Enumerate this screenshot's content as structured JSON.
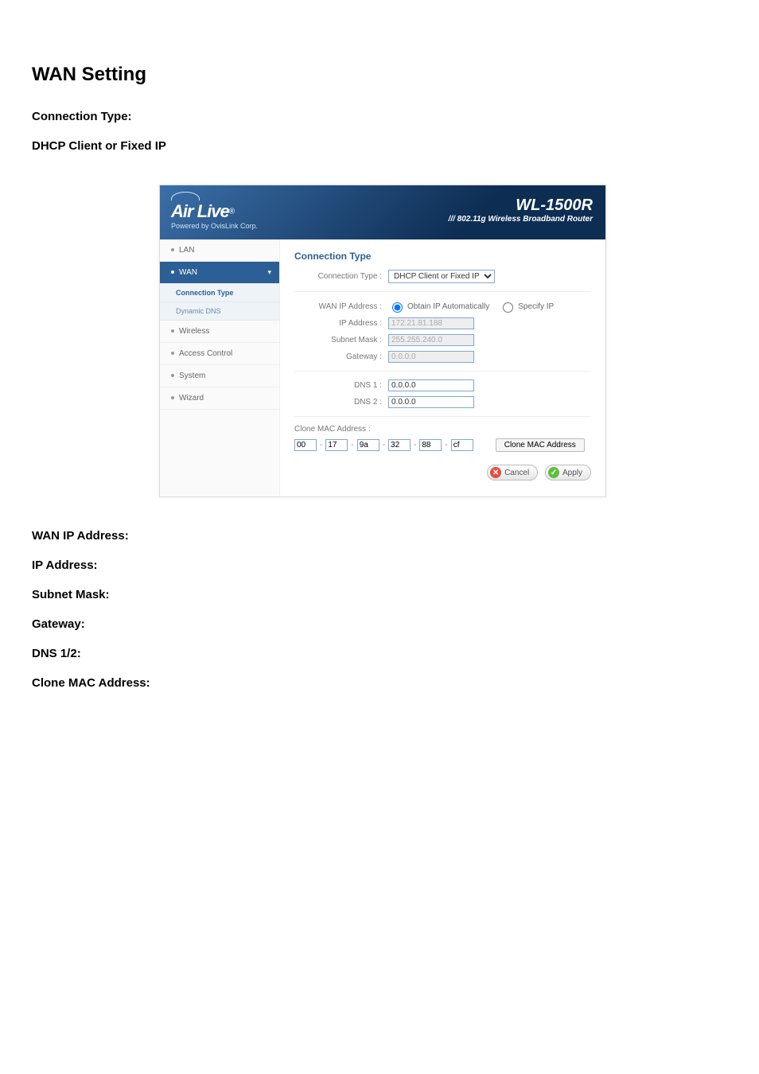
{
  "page": {
    "title": "WAN Setting",
    "section_connection_type": "Connection Type:",
    "sub_dhcp": "DHCP Client or Fixed IP",
    "wan_ip_label": "WAN IP Address:",
    "ip_label": "IP Address:",
    "subnet_label": "Subnet Mask:",
    "gateway_label": "Gateway:",
    "dns_label": "DNS 1/2:",
    "clone_mac_label": "Clone  MAC  Address:"
  },
  "router": {
    "logo_name": "Air Live",
    "logo_reg": "®",
    "logo_sub": "Powered by OvisLink Corp.",
    "model": "WL-1500R",
    "model_desc": "/// 802.11g Wireless Broadband Router",
    "nav": {
      "lan": "LAN",
      "wan": "WAN",
      "wan_sub_conn": "Connection Type",
      "wan_sub_ddns": "Dynamic DNS",
      "wireless": "Wireless",
      "access": "Access Control",
      "system": "System",
      "wizard": "Wizard"
    },
    "panel": {
      "title": "Connection Type",
      "conn_type_label": "Connection Type :",
      "conn_type_value": "DHCP Client or Fixed IP",
      "wan_ip_label": "WAN IP Address :",
      "radio_auto": "Obtain IP Automatically",
      "radio_specify": "Specify IP",
      "ip_label": "IP Address :",
      "ip_value": "172.21.81.188",
      "subnet_label": "Subnet Mask :",
      "subnet_value": "255.255.240.0",
      "gateway_label": "Gateway :",
      "gateway_value": "0.0.0.0",
      "dns1_label": "DNS 1 :",
      "dns1_value": "0.0.0.0",
      "dns2_label": "DNS 2 :",
      "dns2_value": "0.0.0.0",
      "clone_header": "Clone MAC Address :",
      "mac": [
        "00",
        "17",
        "9a",
        "32",
        "88",
        "cf"
      ],
      "clone_btn": "Clone MAC Address",
      "cancel": "Cancel",
      "apply": "Apply"
    }
  }
}
